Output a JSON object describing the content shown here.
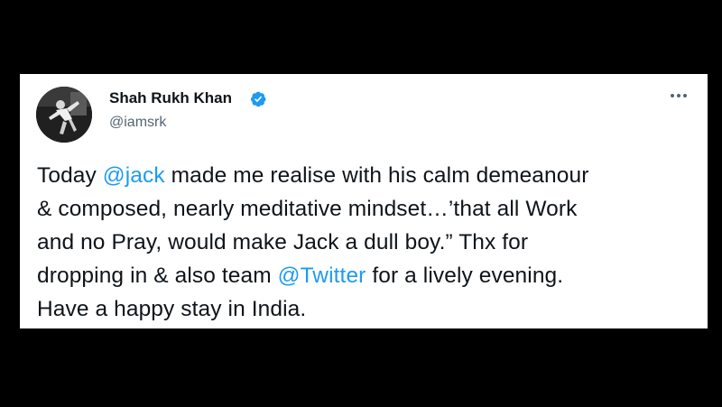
{
  "tweet": {
    "author": {
      "display_name": "Shah Rukh Khan",
      "handle": "@iamsrk",
      "verified": true,
      "avatar_icon": "profile-photo"
    },
    "more_icon": "more-horizontal-icon",
    "text_lines": [
      {
        "before": "Today ",
        "mention": "@jack",
        "after": " made me realise with his calm demeanour"
      },
      {
        "before": "& composed, nearly meditative mindset…’that all Work",
        "mention": "",
        "after": ""
      },
      {
        "before": "and no Pray, would make Jack a dull boy.” Thx for",
        "mention": "",
        "after": ""
      },
      {
        "before": "dropping in & also team ",
        "mention": "@Twitter",
        "after": " for a lively evening."
      },
      {
        "before": "Have a happy stay in India.",
        "mention": "",
        "after": ""
      }
    ]
  },
  "colors": {
    "background": "#000000",
    "card": "#ffffff",
    "text": "#0f1419",
    "secondary": "#536471",
    "link": "#1d9bf0"
  }
}
